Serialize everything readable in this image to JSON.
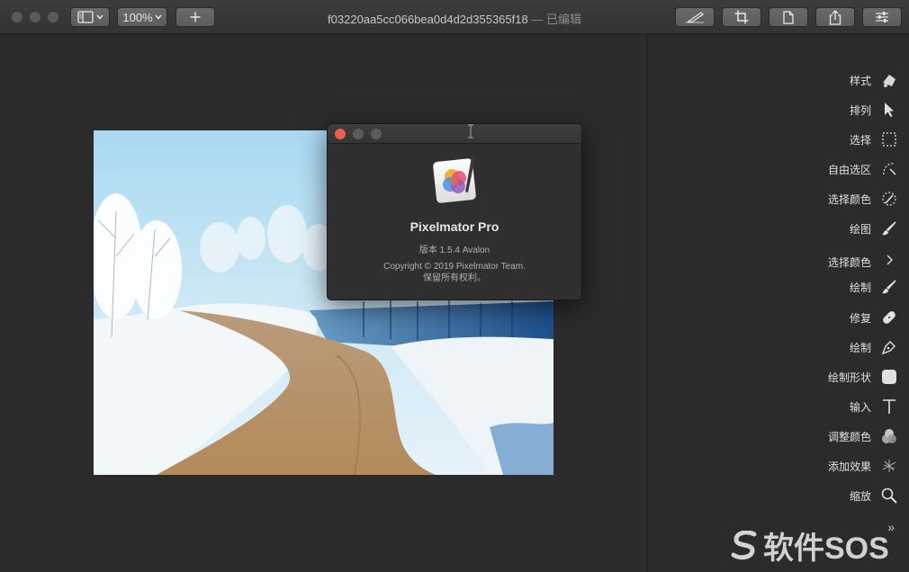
{
  "window": {
    "title": "f03220aa5cc066bea0d4d2d355365f18",
    "title_suffix": " — 已编辑",
    "zoom": "100%"
  },
  "toolbar": {
    "view_menu": "sidebar-toggle",
    "add": "+",
    "right_buttons": [
      "brush-icon",
      "crop-icon",
      "document-icon",
      "share-icon",
      "adjust-icon"
    ]
  },
  "sidebar": {
    "tools": [
      {
        "label": "样式",
        "icon": "style-icon"
      },
      {
        "label": "排列",
        "icon": "arrow-icon"
      },
      {
        "label": "选择",
        "icon": "marquee-icon"
      },
      {
        "label": "自由选区",
        "icon": "lasso-icon"
      },
      {
        "label": "选择颜色",
        "icon": "color-select-icon"
      },
      {
        "label": "绘图",
        "icon": "paint-icon"
      },
      {
        "label": "选择颜色",
        "icon": "eyedropper-icon"
      },
      {
        "label": "绘制",
        "icon": "brush-icon"
      },
      {
        "label": "修复",
        "icon": "bandage-icon"
      },
      {
        "label": "绘制",
        "icon": "pen-icon"
      },
      {
        "label": "绘制形状",
        "icon": "shape-icon"
      },
      {
        "label": "输入",
        "icon": "type-icon"
      },
      {
        "label": "调整颜色",
        "icon": "color-adjust-icon"
      },
      {
        "label": "添加效果",
        "icon": "effects-icon"
      },
      {
        "label": "缩放",
        "icon": "zoom-icon"
      }
    ],
    "more": "»"
  },
  "about": {
    "app_name": "Pixelmator Pro",
    "version": "版本 1.5.4 Avalon",
    "copyright": "Copyright © 2019 Pixelmator Team.",
    "rights": "保留所有权利。"
  },
  "watermark": "软件SOS",
  "colors": {
    "close_red": "#ee5b51",
    "background": "#2b2b2b"
  }
}
